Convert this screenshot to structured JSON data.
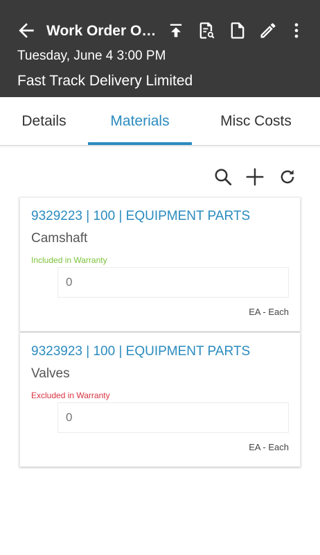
{
  "appbar": {
    "title": "Work Order Op…",
    "subtitle": "Tuesday, June 4 3:00 PM",
    "company": "Fast Track Delivery Limited",
    "background": "#3a3a3a",
    "icons": [
      "back-arrow-icon",
      "upload-icon",
      "document-search-icon",
      "document-icon",
      "edit-pencil-icon",
      "more-vertical-icon"
    ]
  },
  "tabs": [
    {
      "label": "Details",
      "active": false
    },
    {
      "label": "Materials",
      "active": true
    },
    {
      "label": "Misc Costs",
      "active": false
    }
  ],
  "accent_color": "#2a8bbf",
  "toolbar": {
    "icons": [
      "search-icon",
      "add-icon",
      "refresh-icon"
    ]
  },
  "materials": [
    {
      "code": "9329223 | 100 | EQUIPMENT PARTS",
      "name": "Camshaft",
      "warranty": "Included in Warranty",
      "warranty_color": "#7cc23a",
      "quantity_placeholder": "0",
      "unit": "EA - Each"
    },
    {
      "code": "9323923 | 100 | EQUIPMENT PARTS",
      "name": "Valves",
      "warranty": "Excluded in Warranty",
      "warranty_color": "#d9333f",
      "quantity_placeholder": "0",
      "unit": "EA - Each"
    }
  ]
}
